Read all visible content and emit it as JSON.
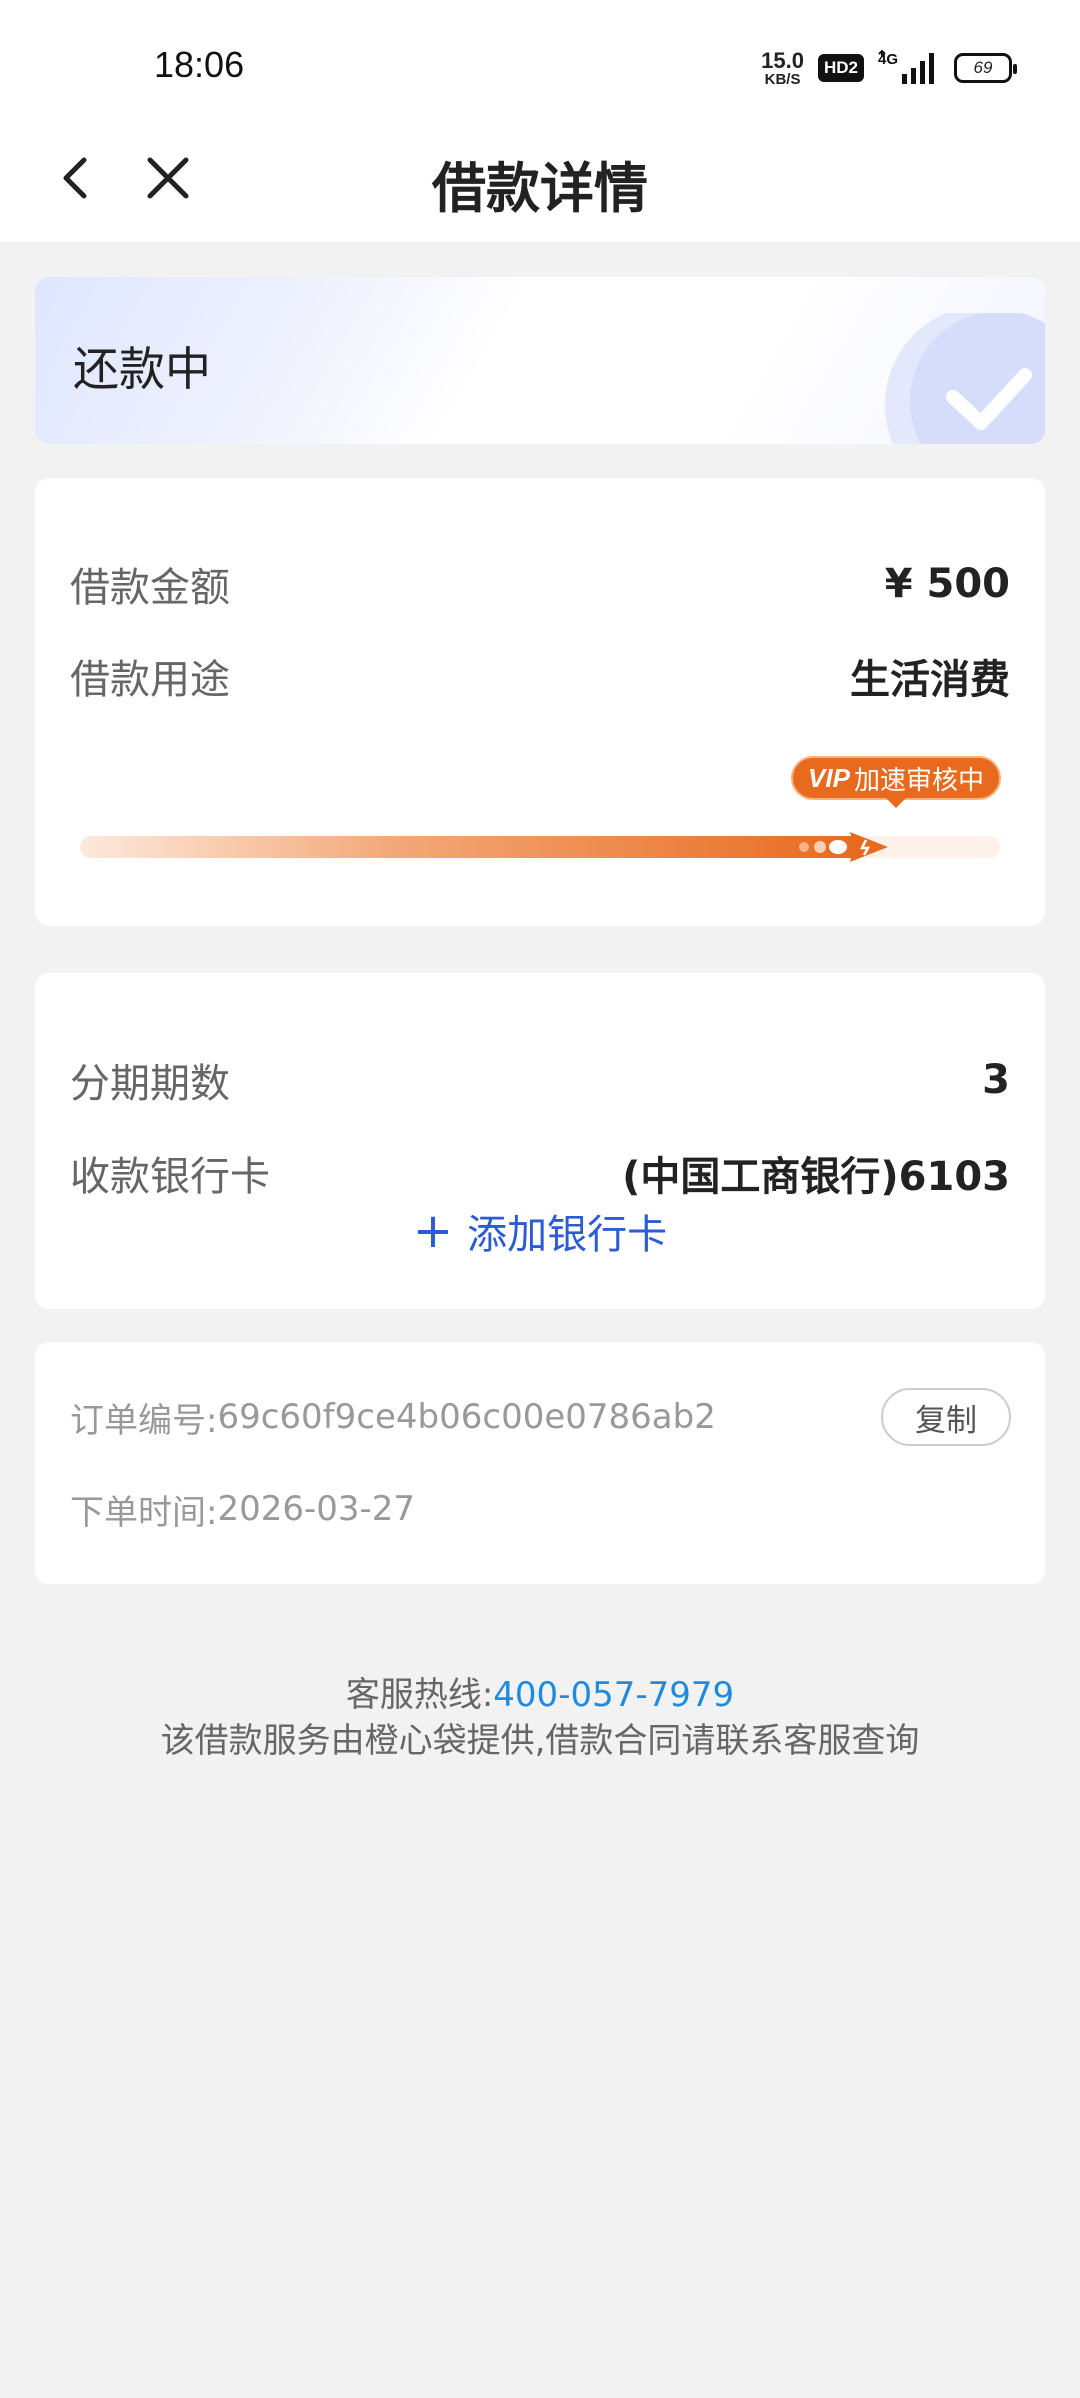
{
  "status_bar": {
    "time": "18:06",
    "net_speed_value": "15.0",
    "net_speed_unit": "KB/S",
    "hd_label": "HD2",
    "network_type": "4G",
    "battery": "69"
  },
  "nav": {
    "title": "借款详情",
    "back_icon": "chevron-left-icon",
    "close_icon": "close-icon"
  },
  "status_card": {
    "status": "还款中",
    "icon": "check-circle-icon"
  },
  "loan": {
    "amount_label": "借款金额",
    "amount_value": "¥ 500",
    "purpose_label": "借款用途",
    "purpose_value": "生活消费",
    "progress_badge_vip": "VIP",
    "progress_badge_text": "加速审核中",
    "progress_fraction": 0.92,
    "accent_color": "#e86a1e"
  },
  "installment": {
    "periods_label": "分期期数",
    "periods_value": "3",
    "bank_label": "收款银行卡",
    "bank_value": "(中国工商银行)6103",
    "add_card_label": "添加银行卡",
    "link_color": "#2d5bd3"
  },
  "order": {
    "number_label": "订单编号:",
    "number_value": "69c60f9ce4b06c00e0786ab2",
    "copy_label": "复制",
    "time_label": "下单时间:",
    "time_value": "2026-03-27"
  },
  "footer": {
    "hotline_label": "客服热线:",
    "hotline_number": "400-057-7979",
    "disclaimer": "该借款服务由橙心袋提供,借款合同请联系客服查询",
    "hotline_color": "#1f8be0"
  }
}
